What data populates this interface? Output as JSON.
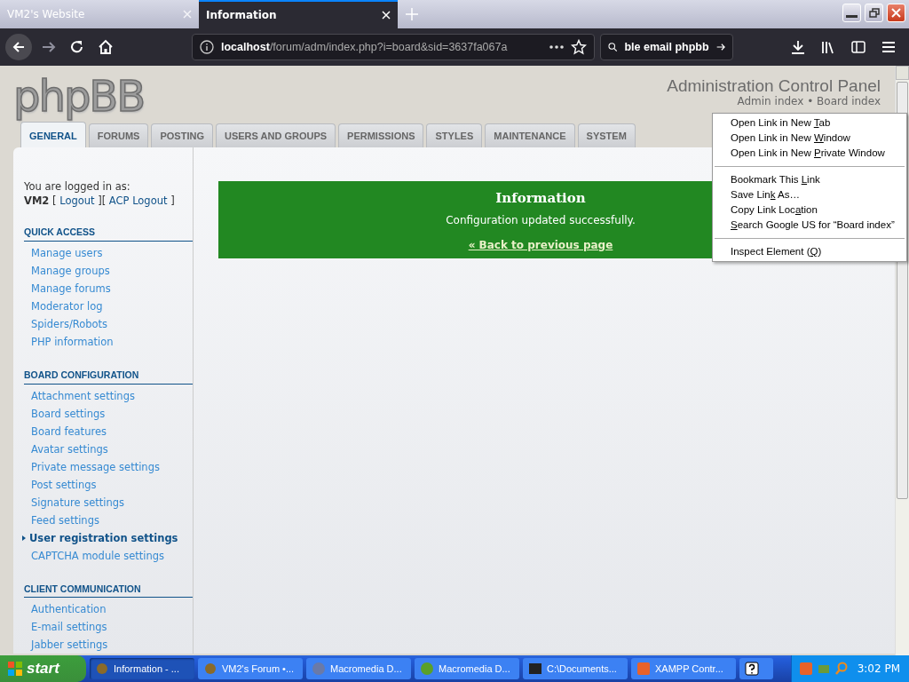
{
  "browser": {
    "tabs": [
      {
        "label": "VM2's Website",
        "selected": false
      },
      {
        "label": "Information",
        "selected": true
      }
    ],
    "url": {
      "host": "localhost",
      "path": "/forum/adm/index.php?i=board&sid=3637fa067a"
    },
    "search": {
      "value": "ble email phpbb"
    }
  },
  "page": {
    "logo": "phpBB",
    "title": "Administration Control Panel",
    "breadcrumb": "Admin index • Board index",
    "tabs": [
      {
        "label": "GENERAL",
        "selected": true
      },
      {
        "label": "FORUMS",
        "selected": false
      },
      {
        "label": "POSTING",
        "selected": false
      },
      {
        "label": "USERS AND GROUPS",
        "selected": false
      },
      {
        "label": "PERMISSIONS",
        "selected": false
      },
      {
        "label": "STYLES",
        "selected": false
      },
      {
        "label": "MAINTENANCE",
        "selected": false
      },
      {
        "label": "SYSTEM",
        "selected": false
      }
    ],
    "login": {
      "intro": "You are logged in as:",
      "user": "VM2",
      "links": [
        "Logout",
        "ACP Logout"
      ],
      "separators": [
        "[",
        "][",
        "]"
      ]
    },
    "sidebar": [
      {
        "heading": "QUICK ACCESS",
        "items": [
          {
            "label": "Manage users",
            "selected": false
          },
          {
            "label": "Manage groups",
            "selected": false
          },
          {
            "label": "Manage forums",
            "selected": false
          },
          {
            "label": "Moderator log",
            "selected": false
          },
          {
            "label": "Spiders/Robots",
            "selected": false
          },
          {
            "label": "PHP information",
            "selected": false
          }
        ]
      },
      {
        "heading": "BOARD CONFIGURATION",
        "items": [
          {
            "label": "Attachment settings",
            "selected": false
          },
          {
            "label": "Board settings",
            "selected": false
          },
          {
            "label": "Board features",
            "selected": false
          },
          {
            "label": "Avatar settings",
            "selected": false
          },
          {
            "label": "Private message settings",
            "selected": false
          },
          {
            "label": "Post settings",
            "selected": false
          },
          {
            "label": "Signature settings",
            "selected": false
          },
          {
            "label": "Feed settings",
            "selected": false
          },
          {
            "label": "User registration settings",
            "selected": true
          },
          {
            "label": "CAPTCHA module settings",
            "selected": false
          }
        ]
      },
      {
        "heading": "CLIENT COMMUNICATION",
        "items": [
          {
            "label": "Authentication",
            "selected": false
          },
          {
            "label": "E-mail settings",
            "selected": false
          },
          {
            "label": "Jabber settings",
            "selected": false
          }
        ]
      }
    ],
    "message": {
      "title": "Information",
      "text": "Configuration updated successfully.",
      "link": "« Back to previous page"
    }
  },
  "context_menu": [
    [
      {
        "before": "Open Link in New ",
        "key": "T",
        "after": "ab"
      },
      {
        "before": "Open Link in New ",
        "key": "W",
        "after": "indow"
      },
      {
        "before": "Open Link in New ",
        "key": "P",
        "after": "rivate Window"
      }
    ],
    [
      {
        "before": "Bookmark This ",
        "key": "L",
        "after": "ink"
      },
      {
        "before": "Save Lin",
        "key": "k",
        "after": " As…"
      },
      {
        "before": "Copy Link Loc",
        "key": "a",
        "after": "tion"
      },
      {
        "key": "S",
        "after": "earch Google US for “Board index”"
      }
    ],
    [
      {
        "before": "Inspect Element (",
        "key": "Q",
        "after": ")"
      }
    ]
  ],
  "taskbar": {
    "start": "start",
    "tasks": [
      {
        "label": "Information - ...",
        "selected": true
      },
      {
        "label": "VM2's Forum •...",
        "selected": false
      },
      {
        "label": "Macromedia D...",
        "selected": false
      },
      {
        "label": "Macromedia D...",
        "selected": false
      },
      {
        "label": "C:\\Documents...",
        "selected": false
      },
      {
        "label": "XAMPP Contr...",
        "selected": false
      }
    ],
    "clock": "3:02 PM"
  }
}
